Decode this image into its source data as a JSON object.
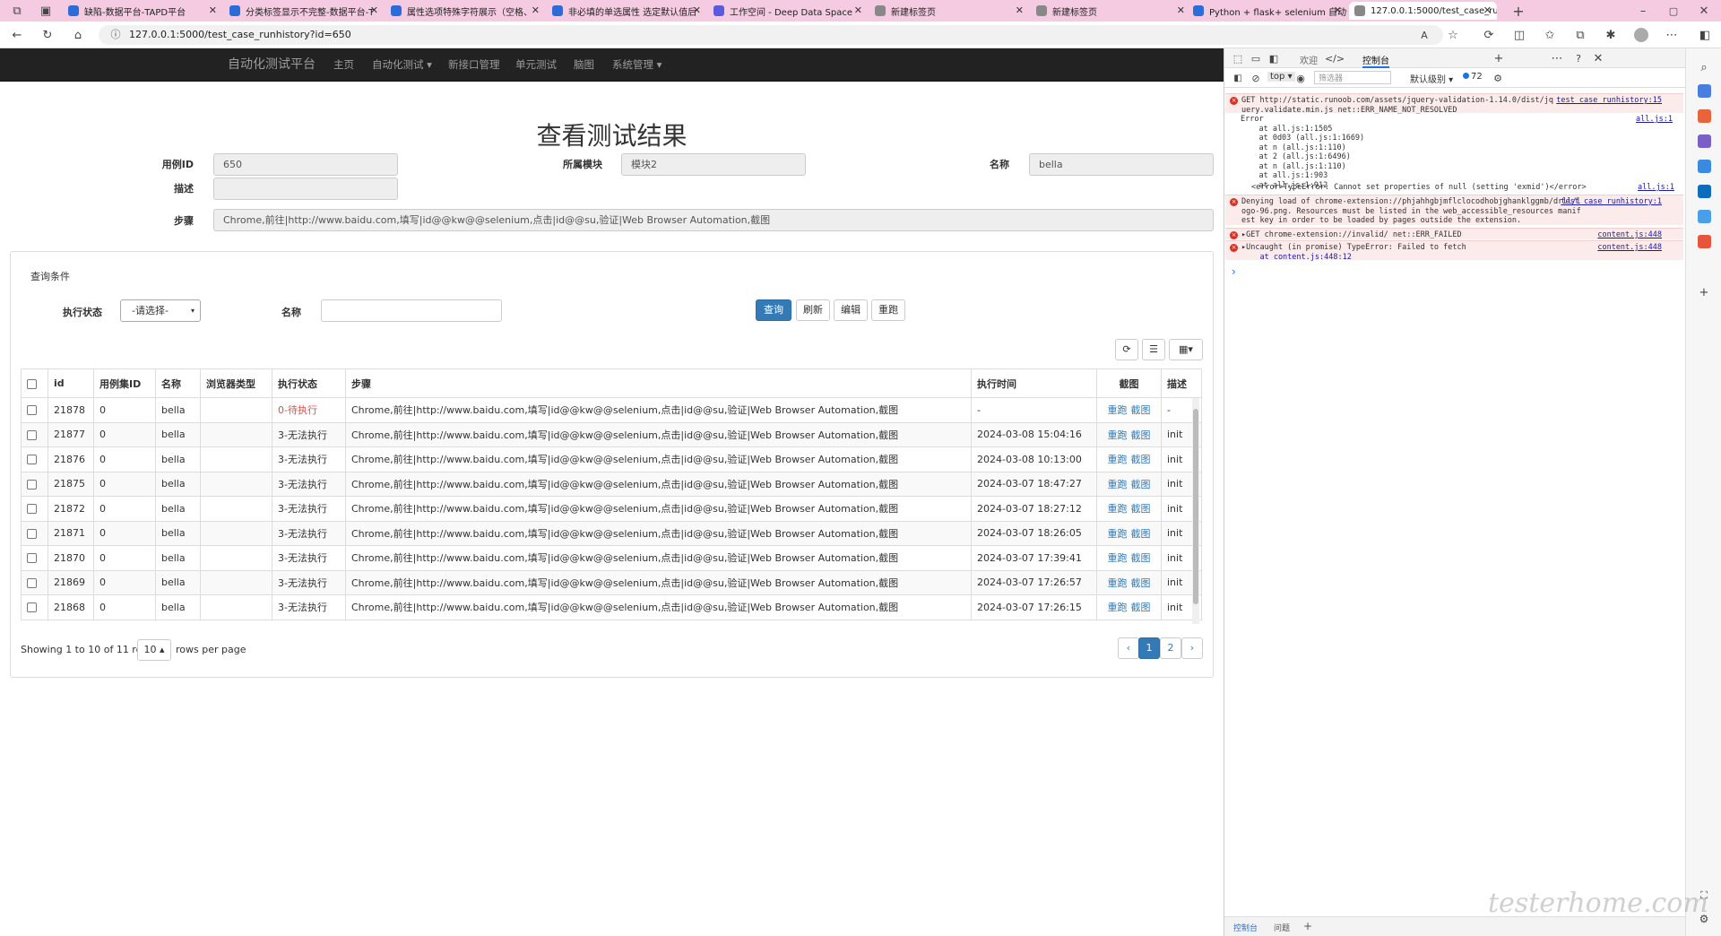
{
  "browser": {
    "tabs": [
      {
        "title": "缺陷-数据平台-TAPD平台",
        "icon_color": "#2b6cd8"
      },
      {
        "title": "分类标签显示不完整-数据平台-T",
        "icon_color": "#2b6cd8"
      },
      {
        "title": "属性选项特殊字符展示（空格、",
        "icon_color": "#2b6cd8"
      },
      {
        "title": "非必填的单选属性 选定默认值后",
        "icon_color": "#2b6cd8"
      },
      {
        "title": "工作空间 - Deep Data Space",
        "icon_color": "#5a5adf"
      },
      {
        "title": "新建标签页",
        "icon_color": "#888888"
      },
      {
        "title": "新建标签页",
        "icon_color": "#888888"
      },
      {
        "title": "Python + flask+ selenium 自动化",
        "icon_color": "#2b6cd8"
      },
      {
        "title": "127.0.0.1:5000/test_case_runhist",
        "icon_color": "#888888"
      }
    ],
    "url": "127.0.0.1:5000/test_case_runhistory?id=650",
    "new_tab": "+",
    "window_controls": [
      "–",
      "▢",
      "✕"
    ]
  },
  "navbar": {
    "brand": "自动化测试平台",
    "items": [
      "主页",
      "自动化测试 ▾",
      "新接口管理",
      "单元测试",
      "脑图",
      "系统管理 ▾"
    ]
  },
  "page": {
    "title": "查看测试结果",
    "fields": {
      "case_id_label": "用例ID",
      "case_id_value": "650",
      "module_label": "所属模块",
      "module_value": "模块2",
      "name_label": "名称",
      "name_value": "bella",
      "desc_label": "描述",
      "desc_value": "",
      "steps_label": "步骤",
      "steps_value": "Chrome,前往|http://www.baidu.com,填写|id@@kw@@selenium,点击|id@@su,验证|Web Browser Automation,截图"
    }
  },
  "query": {
    "section_title": "查询条件",
    "status_label": "执行状态",
    "status_value": "-请选择-",
    "name_label": "名称",
    "name_value": "",
    "buttons": [
      "查询",
      "刷新",
      "编辑",
      "重跑"
    ]
  },
  "table": {
    "headers": [
      "id",
      "用例集ID",
      "名称",
      "浏览器类型",
      "执行状态",
      "步骤",
      "执行时间",
      "截图",
      "描述"
    ],
    "rows": [
      {
        "id": "21878",
        "set": "0",
        "name": "bella",
        "browser": "",
        "status": "0-待执行",
        "steps": "Chrome,前往|http://www.baidu.com,填写|id@@kw@@selenium,点击|id@@su,验证|Web Browser Automation,截图",
        "time": "-",
        "desc": "-"
      },
      {
        "id": "21877",
        "set": "0",
        "name": "bella",
        "browser": "",
        "status": "3-无法执行",
        "steps": "Chrome,前往|http://www.baidu.com,填写|id@@kw@@selenium,点击|id@@su,验证|Web Browser Automation,截图",
        "time": "2024-03-08 15:04:16",
        "desc": "init"
      },
      {
        "id": "21876",
        "set": "0",
        "name": "bella",
        "browser": "",
        "status": "3-无法执行",
        "steps": "Chrome,前往|http://www.baidu.com,填写|id@@kw@@selenium,点击|id@@su,验证|Web Browser Automation,截图",
        "time": "2024-03-08 10:13:00",
        "desc": "init"
      },
      {
        "id": "21875",
        "set": "0",
        "name": "bella",
        "browser": "",
        "status": "3-无法执行",
        "steps": "Chrome,前往|http://www.baidu.com,填写|id@@kw@@selenium,点击|id@@su,验证|Web Browser Automation,截图",
        "time": "2024-03-07 18:47:27",
        "desc": "init"
      },
      {
        "id": "21872",
        "set": "0",
        "name": "bella",
        "browser": "",
        "status": "3-无法执行",
        "steps": "Chrome,前往|http://www.baidu.com,填写|id@@kw@@selenium,点击|id@@su,验证|Web Browser Automation,截图",
        "time": "2024-03-07 18:27:12",
        "desc": "init"
      },
      {
        "id": "21871",
        "set": "0",
        "name": "bella",
        "browser": "",
        "status": "3-无法执行",
        "steps": "Chrome,前往|http://www.baidu.com,填写|id@@kw@@selenium,点击|id@@su,验证|Web Browser Automation,截图",
        "time": "2024-03-07 18:26:05",
        "desc": "init"
      },
      {
        "id": "21870",
        "set": "0",
        "name": "bella",
        "browser": "",
        "status": "3-无法执行",
        "steps": "Chrome,前往|http://www.baidu.com,填写|id@@kw@@selenium,点击|id@@su,验证|Web Browser Automation,截图",
        "time": "2024-03-07 17:39:41",
        "desc": "init"
      },
      {
        "id": "21869",
        "set": "0",
        "name": "bella",
        "browser": "",
        "status": "3-无法执行",
        "steps": "Chrome,前往|http://www.baidu.com,填写|id@@kw@@selenium,点击|id@@su,验证|Web Browser Automation,截图",
        "time": "2024-03-07 17:26:57",
        "desc": "init"
      },
      {
        "id": "21868",
        "set": "0",
        "name": "bella",
        "browser": "",
        "status": "3-无法执行",
        "steps": "Chrome,前往|http://www.baidu.com,填写|id@@kw@@selenium,点击|id@@su,验证|Web Browser Automation,截图",
        "time": "2024-03-07 17:26:15",
        "desc": "init"
      }
    ],
    "rerun_label": "重跑",
    "screenshot_label": "截图",
    "footer_text": "Showing 1 to 10 of 11 rows",
    "page_size": "10 ▴",
    "rows_per_page": "rows per page",
    "pages": [
      "‹",
      "1",
      "2",
      "›"
    ]
  },
  "devtools": {
    "tabs": [
      "欢迎",
      "控制台"
    ],
    "context": "top ▾",
    "filter_placeholder": "筛选器",
    "level": "默认级别 ▾",
    "issue_count": "72",
    "messages": {
      "m1_text": "GET http://static.runoob.com/assets/jquery-validation-1.14.0/dist/jquery.validate.min.js net::ERR_NAME_NOT_RESOLVED",
      "m1_src": "test_case_runhistory:15",
      "m2_lines": [
        "Error",
        "    at all.js:1:1505",
        "    at 0d03 (all.js:1:1669)",
        "    at n (all.js:1:110)",
        "    at 2 (all.js:1:6496)",
        "    at n (all.js:1:110)",
        "    at all.js:1:903",
        "    at all.js:1:912"
      ],
      "m2_src": "all.js:1",
      "m2b_text": "<error>TypeError: Cannot set properties of null (setting 'exmid')</error>",
      "m2b_src": "all.js:1",
      "m3_text": "Denying load of chrome-extension://phjahhgbjmflclocodhobjghanklggmb/drll/logo-96.png. Resources must be listed in the web_accessible_resources manifest key in order to be loaded by pages outside the extension.",
      "m3_src": "test_case_runhistory:1",
      "m4_text": "▸GET chrome-extension://invalid/ net::ERR_FAILED",
      "m4_src": "content.js:448",
      "m5_text": "▸Uncaught (in promise) TypeError: Failed to fetch",
      "m5_sub": "    at content.js:448:12",
      "m5_src": "content.js:448",
      "prompt": "›"
    },
    "bottom_tabs": [
      "控制台",
      "问题",
      "+"
    ]
  },
  "watermark": "testerhome.com"
}
